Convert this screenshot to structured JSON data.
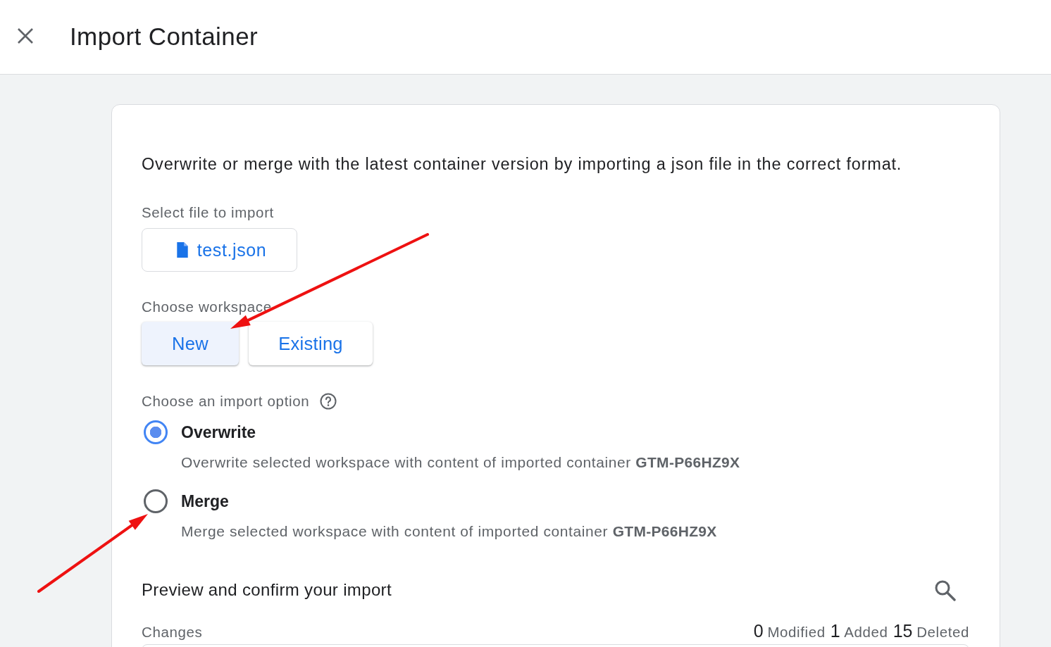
{
  "header": {
    "title": "Import Container"
  },
  "intro": "Overwrite or merge with the latest container version by importing a json file in the correct format.",
  "file_select": {
    "label": "Select file to import",
    "file_name": "test.json"
  },
  "workspace": {
    "label": "Choose workspace",
    "options": [
      {
        "label": "New",
        "selected": true
      },
      {
        "label": "Existing",
        "selected": false
      }
    ]
  },
  "import_option": {
    "label": "Choose an import option",
    "options": [
      {
        "label": "Overwrite",
        "selected": true,
        "description": "Overwrite selected workspace with content of imported container **GTM-P66HZ9X**"
      },
      {
        "label": "Merge",
        "selected": false,
        "description": "Merge selected workspace with content of imported container **GTM-P66HZ9X**"
      }
    ]
  },
  "preview": {
    "title": "Preview and confirm your import",
    "changes_label": "Changes",
    "counts": [
      {
        "number": "0",
        "caption": "Modified"
      },
      {
        "number": "1",
        "caption": "Added"
      },
      {
        "number": "15",
        "caption": "Deleted"
      }
    ]
  }
}
